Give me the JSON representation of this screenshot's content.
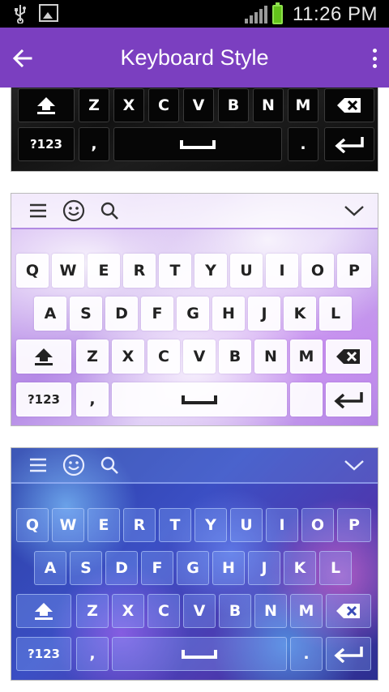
{
  "status_bar": {
    "time": "11:26 PM",
    "icons": [
      "usb-icon",
      "image-icon",
      "signal-icon",
      "battery-charging-icon"
    ]
  },
  "app_bar": {
    "title": "Keyboard Style",
    "back_icon": "arrow-left-icon",
    "menu_icon": "more-vert-icon"
  },
  "keyboard_previews": [
    {
      "name": "dark",
      "row3_letters": [
        "Z",
        "X",
        "C",
        "V",
        "B",
        "N",
        "M"
      ],
      "bottom_row": {
        "symbols": "?123",
        "comma": ",",
        "period": "."
      }
    },
    {
      "name": "purple-clouds",
      "toolbar_icons": [
        "menu-icon",
        "emoji-icon",
        "search-icon",
        "chevron-down-icon"
      ],
      "row1": [
        "Q",
        "W",
        "E",
        "R",
        "T",
        "Y",
        "U",
        "I",
        "O",
        "P"
      ],
      "row2": [
        "A",
        "S",
        "D",
        "F",
        "G",
        "H",
        "J",
        "K",
        "L"
      ],
      "row3_letters": [
        "Z",
        "X",
        "C",
        "V",
        "B",
        "N",
        "M"
      ],
      "bottom_row": {
        "symbols": "?123",
        "comma": ","
      }
    },
    {
      "name": "blue-bokeh",
      "toolbar_icons": [
        "menu-icon",
        "emoji-icon",
        "search-icon",
        "chevron-down-icon"
      ],
      "row1": [
        "Q",
        "W",
        "E",
        "R",
        "T",
        "Y",
        "U",
        "I",
        "O",
        "P"
      ],
      "row2": [
        "A",
        "S",
        "D",
        "F",
        "G",
        "H",
        "J",
        "K",
        "L"
      ],
      "row3_letters": [
        "Z",
        "X",
        "C",
        "V",
        "B",
        "N",
        "M"
      ],
      "bottom_row": {
        "symbols": "?123",
        "comma": ",",
        "period": "."
      }
    }
  ],
  "colors": {
    "app_bar": "#7b3fc0",
    "status_bar": "#000000"
  }
}
